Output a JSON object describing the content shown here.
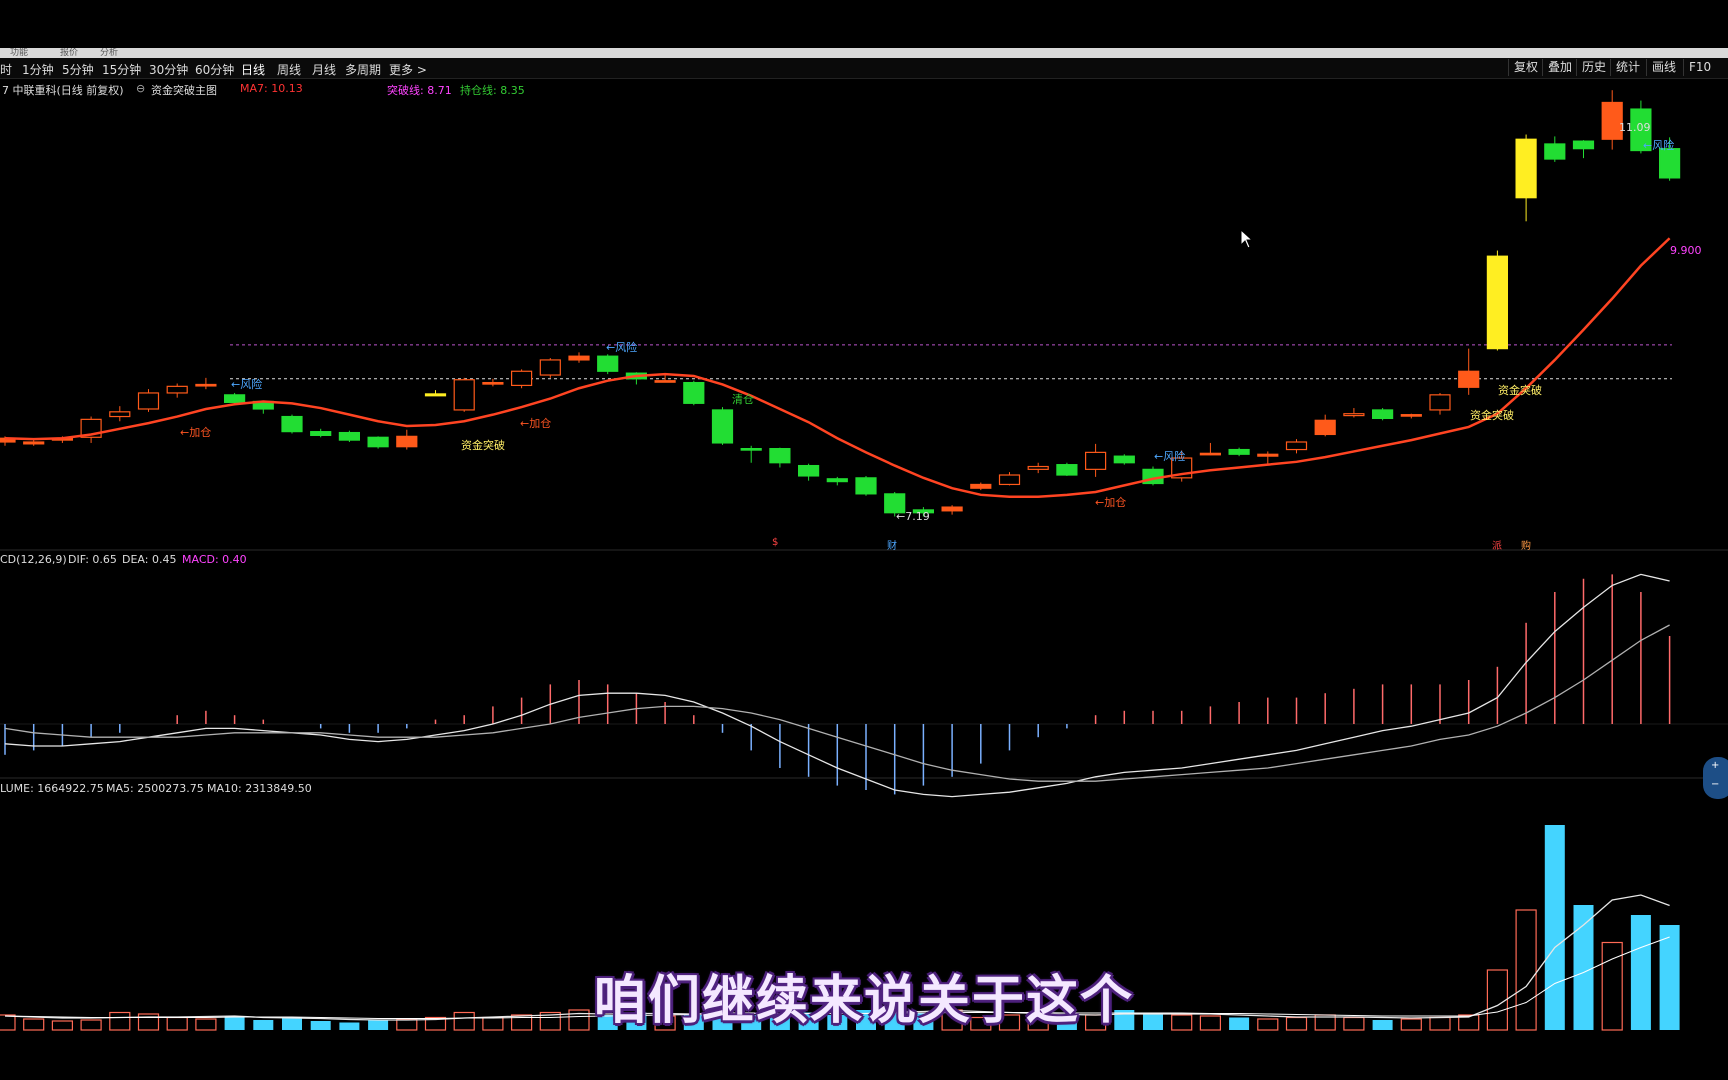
{
  "toolbar": {
    "timeframes": [
      "时",
      "1分钟",
      "5分钟",
      "15分钟",
      "30分钟",
      "60分钟",
      "日线",
      "周线",
      "月线",
      "多周期",
      "更多 >"
    ],
    "right_buttons": [
      "复权",
      "叠加",
      "历史",
      "统计",
      "画线",
      "F10"
    ]
  },
  "main_panel": {
    "title": "7 中联重科(日线 前复权)",
    "indicator_name": "资金突破主图",
    "ma7": "MA7: 10.13",
    "breakthrough": "突破线: 8.71",
    "hold": "持仓线: 8.35",
    "breakthrough_color": "#ff44ff",
    "hold_color": "#33cc33"
  },
  "macd_panel": {
    "label": "CD(12,26,9)",
    "dif": "DIF: 0.65",
    "dea": "DEA: 0.45",
    "macd": "MACD: 0.40"
  },
  "volume_panel": {
    "label": "LUME: 1664922.75",
    "ma5": "MA5: 2500273.75",
    "ma10": "MA10: 2313849.50"
  },
  "annotations": {
    "risk": "←风险",
    "add": "←加仓",
    "breakout": "资金突破",
    "clear": "清仓",
    "high_price": "11.09",
    "low_price": "←7.19",
    "last_price": "9.900",
    "markers": [
      "$",
      "财",
      "派",
      "购"
    ]
  },
  "subtitle": "咱们继续来说关于这个",
  "colors": {
    "up": "#ff5a1a",
    "down": "#22dd33",
    "signal": "#ffee22",
    "ma": "#ff4422",
    "volume_up": "#ff6a55",
    "volume_down": "#44d4ff"
  },
  "chart_data": {
    "type": "candlestick",
    "candles": [
      [
        7.68,
        7.72,
        7.64,
        7.74
      ],
      [
        7.66,
        7.68,
        7.64,
        7.71
      ],
      [
        7.7,
        7.72,
        7.67,
        7.74
      ],
      [
        7.73,
        7.92,
        7.67,
        7.95
      ],
      [
        7.95,
        8.0,
        7.9,
        8.06
      ],
      [
        8.03,
        8.2,
        8.0,
        8.24
      ],
      [
        8.2,
        8.27,
        8.15,
        8.3
      ],
      [
        8.28,
        8.29,
        8.24,
        8.36
      ],
      [
        8.18,
        8.1,
        8.07,
        8.2
      ],
      [
        8.11,
        8.03,
        7.98,
        8.12
      ],
      [
        7.95,
        7.79,
        7.77,
        7.97
      ],
      [
        7.79,
        7.75,
        7.73,
        7.82
      ],
      [
        7.78,
        7.7,
        7.68,
        7.8
      ],
      [
        7.73,
        7.63,
        7.61,
        7.74
      ],
      [
        7.63,
        7.74,
        7.6,
        7.81
      ],
      [
        8.17,
        8.19,
        8.17,
        8.23
      ],
      [
        8.02,
        8.34,
        8.0,
        8.36
      ],
      [
        8.31,
        8.31,
        8.27,
        8.35
      ],
      [
        8.28,
        8.43,
        8.25,
        8.45
      ],
      [
        8.39,
        8.55,
        8.36,
        8.57
      ],
      [
        8.55,
        8.59,
        8.52,
        8.63
      ],
      [
        8.59,
        8.43,
        8.4,
        8.61
      ],
      [
        8.41,
        8.35,
        8.29,
        8.42
      ],
      [
        8.33,
        8.33,
        8.32,
        8.4
      ],
      [
        8.31,
        8.09,
        8.07,
        8.33
      ],
      [
        8.02,
        7.67,
        7.65,
        8.05
      ],
      [
        7.61,
        7.6,
        7.46,
        7.64
      ],
      [
        7.61,
        7.46,
        7.41,
        7.62
      ],
      [
        7.43,
        7.32,
        7.27,
        7.45
      ],
      [
        7.29,
        7.26,
        7.22,
        7.31
      ],
      [
        7.3,
        7.13,
        7.11,
        7.32
      ],
      [
        7.13,
        6.93,
        6.89,
        7.15
      ],
      [
        6.96,
        6.93,
        6.89,
        6.99
      ],
      [
        6.95,
        6.99,
        6.91,
        7.01
      ],
      [
        7.19,
        7.23,
        7.17,
        7.25
      ],
      [
        7.23,
        7.33,
        7.22,
        7.36
      ],
      [
        7.39,
        7.42,
        7.35,
        7.46
      ],
      [
        7.44,
        7.33,
        7.32,
        7.46
      ],
      [
        7.39,
        7.57,
        7.31,
        7.66
      ],
      [
        7.53,
        7.46,
        7.44,
        7.55
      ],
      [
        7.39,
        7.24,
        7.22,
        7.42
      ],
      [
        7.3,
        7.51,
        7.26,
        7.59
      ],
      [
        7.55,
        7.56,
        7.54,
        7.67
      ],
      [
        7.6,
        7.55,
        7.53,
        7.62
      ],
      [
        7.53,
        7.55,
        7.45,
        7.58
      ],
      [
        7.6,
        7.68,
        7.56,
        7.71
      ],
      [
        7.76,
        7.91,
        7.74,
        7.97
      ],
      [
        7.96,
        7.98,
        7.94,
        8.04
      ],
      [
        8.02,
        7.93,
        7.91,
        8.04
      ],
      [
        7.96,
        7.97,
        7.93,
        7.98
      ],
      [
        8.02,
        8.18,
        7.97,
        8.2
      ],
      [
        8.26,
        8.43,
        8.18,
        8.67
      ],
      [
        8.67,
        9.65,
        8.65,
        9.71
      ],
      [
        10.27,
        10.89,
        10.02,
        10.94
      ],
      [
        10.84,
        10.68,
        10.65,
        10.92
      ],
      [
        10.87,
        10.79,
        10.69,
        10.88
      ],
      [
        10.89,
        11.28,
        10.78,
        11.41
      ],
      [
        11.21,
        10.77,
        10.74,
        11.3
      ],
      [
        10.79,
        10.48,
        10.45,
        10.91
      ]
    ],
    "ma7": [
      7.72,
      7.71,
      7.72,
      7.76,
      7.82,
      7.88,
      7.95,
      8.03,
      8.08,
      8.11,
      8.09,
      8.04,
      7.97,
      7.9,
      7.85,
      7.86,
      7.9,
      7.97,
      8.05,
      8.14,
      8.25,
      8.33,
      8.38,
      8.4,
      8.38,
      8.29,
      8.17,
      8.03,
      7.89,
      7.72,
      7.57,
      7.43,
      7.3,
      7.19,
      7.12,
      7.1,
      7.1,
      7.12,
      7.15,
      7.22,
      7.29,
      7.34,
      7.38,
      7.41,
      7.44,
      7.47,
      7.52,
      7.58,
      7.64,
      7.7,
      7.77,
      7.84,
      7.98,
      8.25,
      8.55,
      8.87,
      9.2,
      9.55,
      9.84
    ],
    "macd": {
      "dif": [
        -0.09,
        -0.1,
        -0.1,
        -0.09,
        -0.08,
        -0.06,
        -0.04,
        -0.02,
        -0.02,
        -0.03,
        -0.04,
        -0.05,
        -0.07,
        -0.08,
        -0.07,
        -0.05,
        -0.03,
        0.0,
        0.04,
        0.09,
        0.13,
        0.14,
        0.14,
        0.13,
        0.1,
        0.05,
        -0.01,
        -0.08,
        -0.14,
        -0.2,
        -0.25,
        -0.3,
        -0.32,
        -0.33,
        -0.32,
        -0.31,
        -0.29,
        -0.27,
        -0.24,
        -0.22,
        -0.21,
        -0.2,
        -0.18,
        -0.16,
        -0.14,
        -0.12,
        -0.09,
        -0.06,
        -0.03,
        -0.01,
        0.02,
        0.05,
        0.12,
        0.28,
        0.42,
        0.53,
        0.63,
        0.68,
        0.65
      ],
      "dea": [
        -0.02,
        -0.04,
        -0.05,
        -0.06,
        -0.06,
        -0.06,
        -0.06,
        -0.05,
        -0.04,
        -0.04,
        -0.04,
        -0.04,
        -0.05,
        -0.06,
        -0.06,
        -0.06,
        -0.05,
        -0.04,
        -0.02,
        0.0,
        0.03,
        0.05,
        0.07,
        0.08,
        0.08,
        0.07,
        0.05,
        0.02,
        -0.02,
        -0.06,
        -0.1,
        -0.14,
        -0.18,
        -0.21,
        -0.23,
        -0.25,
        -0.26,
        -0.26,
        -0.26,
        -0.25,
        -0.24,
        -0.23,
        -0.22,
        -0.21,
        -0.2,
        -0.18,
        -0.16,
        -0.14,
        -0.12,
        -0.1,
        -0.07,
        -0.05,
        -0.01,
        0.05,
        0.12,
        0.2,
        0.29,
        0.38,
        0.45
      ]
    },
    "volume": [
      0.3,
      0.22,
      0.18,
      0.2,
      0.35,
      0.32,
      0.25,
      0.22,
      0.28,
      0.2,
      0.25,
      0.18,
      0.15,
      0.2,
      0.22,
      0.25,
      0.35,
      0.25,
      0.3,
      0.35,
      0.4,
      0.3,
      0.35,
      0.28,
      0.3,
      0.45,
      0.3,
      0.25,
      0.35,
      0.3,
      0.4,
      0.45,
      0.35,
      0.4,
      0.25,
      0.3,
      0.35,
      0.28,
      0.3,
      0.4,
      0.35,
      0.3,
      0.28,
      0.25,
      0.22,
      0.25,
      0.3,
      0.25,
      0.2,
      0.22,
      0.25,
      0.3,
      1.2,
      2.4,
      4.1,
      2.5,
      1.75,
      2.3,
      2.1,
      1.25
    ],
    "volume_ma5": [
      0.28,
      0.26,
      0.24,
      0.24,
      0.25,
      0.26,
      0.26,
      0.27,
      0.28,
      0.25,
      0.24,
      0.23,
      0.21,
      0.2,
      0.2,
      0.21,
      0.24,
      0.26,
      0.28,
      0.3,
      0.33,
      0.32,
      0.33,
      0.33,
      0.32,
      0.34,
      0.34,
      0.32,
      0.33,
      0.33,
      0.33,
      0.36,
      0.37,
      0.39,
      0.37,
      0.35,
      0.33,
      0.31,
      0.3,
      0.32,
      0.32,
      0.32,
      0.32,
      0.3,
      0.28,
      0.26,
      0.26,
      0.26,
      0.25,
      0.24,
      0.25,
      0.26,
      0.49,
      0.87,
      1.65,
      2.1,
      2.6,
      2.7,
      2.49,
      1.95
    ],
    "volume_ma10": [
      0.28,
      0.27,
      0.26,
      0.25,
      0.25,
      0.25,
      0.25,
      0.25,
      0.26,
      0.26,
      0.26,
      0.25,
      0.24,
      0.23,
      0.23,
      0.23,
      0.24,
      0.24,
      0.25,
      0.25,
      0.27,
      0.28,
      0.29,
      0.3,
      0.31,
      0.33,
      0.33,
      0.32,
      0.33,
      0.33,
      0.33,
      0.34,
      0.34,
      0.35,
      0.35,
      0.35,
      0.35,
      0.34,
      0.34,
      0.34,
      0.34,
      0.34,
      0.33,
      0.33,
      0.32,
      0.31,
      0.3,
      0.29,
      0.28,
      0.28,
      0.28,
      0.28,
      0.36,
      0.55,
      0.93,
      1.15,
      1.42,
      1.65,
      1.86,
      1.94
    ],
    "ylim_price": [
      6.8,
      11.2
    ]
  }
}
